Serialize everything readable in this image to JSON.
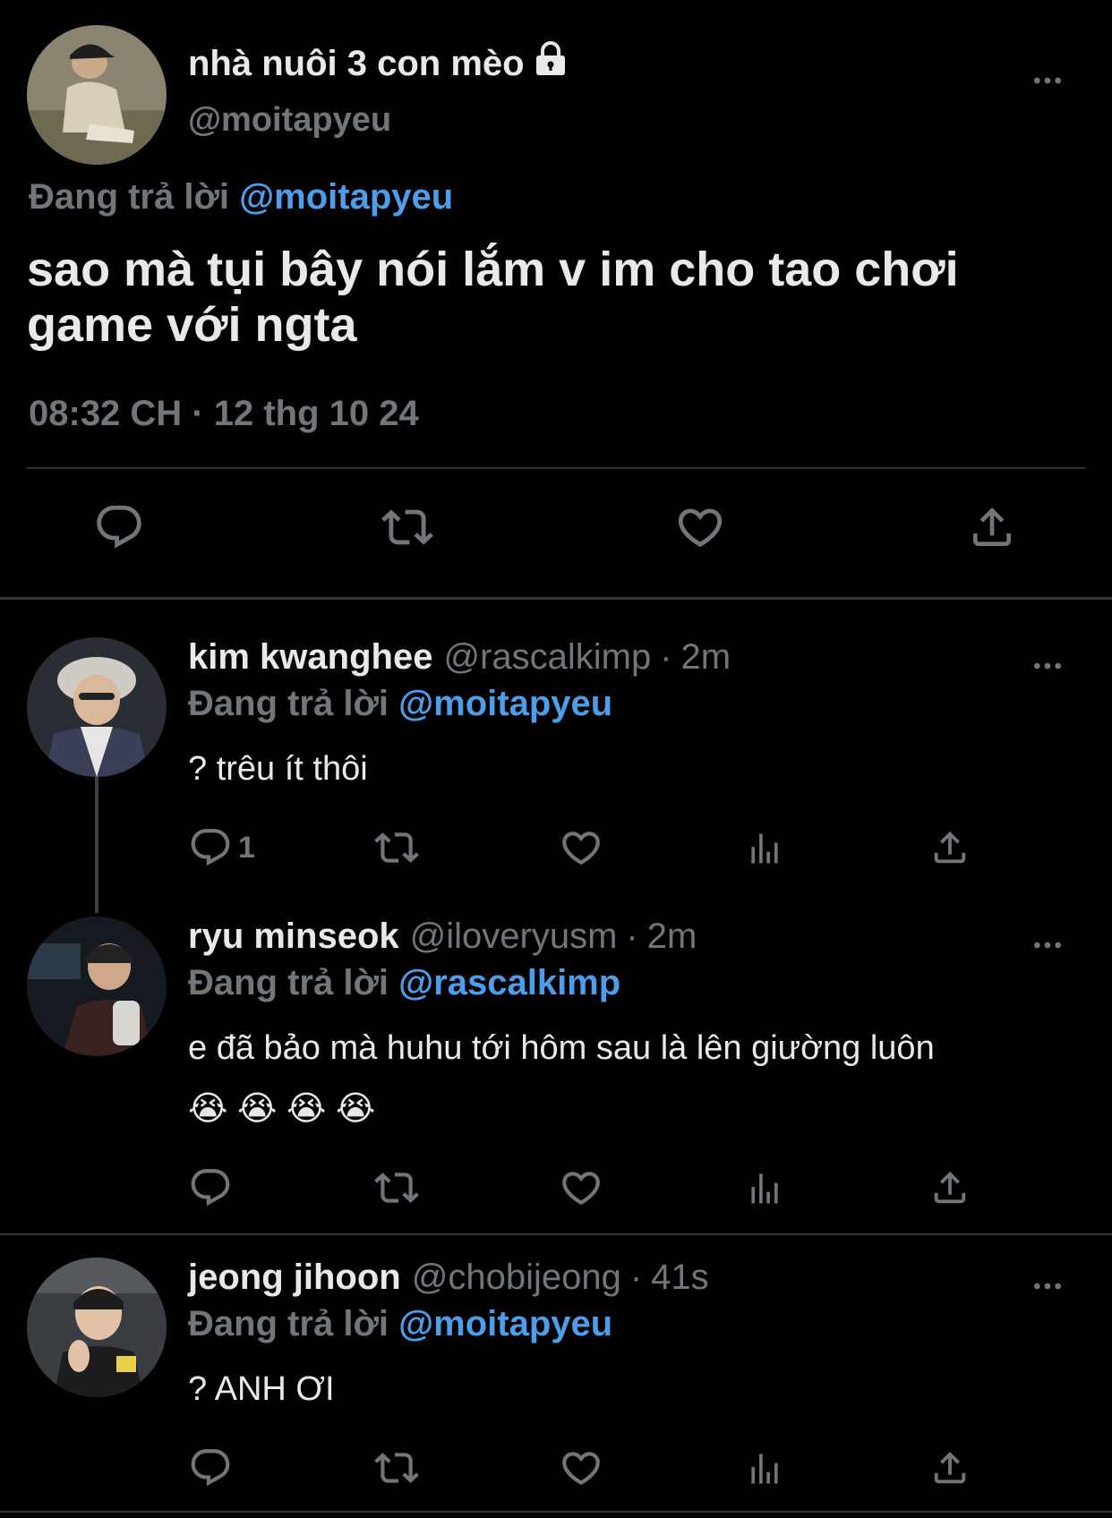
{
  "colors": {
    "background": "#000000",
    "text": "#e7e9ea",
    "muted": "#71767b",
    "mention": "#4c9eeb",
    "divider": "#2f3336"
  },
  "main_tweet": {
    "display_name": "nhà nuôi 3 con mèo",
    "handle": "@moitapyeu",
    "reply_label": "Đang trả lời",
    "reply_mention": "@moitapyeu",
    "text": "sao mà tụi bây nói lắm v im cho tao chơi game với ngta",
    "timestamp": "08:32 CH · 12 thg 10 24",
    "icons": [
      "lock-icon",
      "more-icon",
      "reply-icon",
      "retweet-icon",
      "like-icon",
      "share-icon"
    ]
  },
  "replies": [
    {
      "display_name": "kim kwanghee",
      "handle": "@rascalkimp",
      "separator": "·",
      "time": "2m",
      "reply_label": "Đang trả lời",
      "reply_mention": "@moitapyeu",
      "text": "? trêu ít thôi",
      "reply_count": "1"
    },
    {
      "display_name": "ryu minseok",
      "handle": "@iloveryusm",
      "separator": "·",
      "time": "2m",
      "reply_label": "Đang trả lời",
      "reply_mention": "@rascalkimp",
      "text": "e đã bảo mà huhu tới hôm sau là lên giường luôn",
      "emojis": "😭 😭 😭 😭"
    },
    {
      "display_name": "jeong jihoon",
      "handle": "@chobijeong",
      "separator": "·",
      "time": "41s",
      "reply_label": "Đang trả lời",
      "reply_mention": "@moitapyeu",
      "text": "? ANH ƠI"
    }
  ]
}
